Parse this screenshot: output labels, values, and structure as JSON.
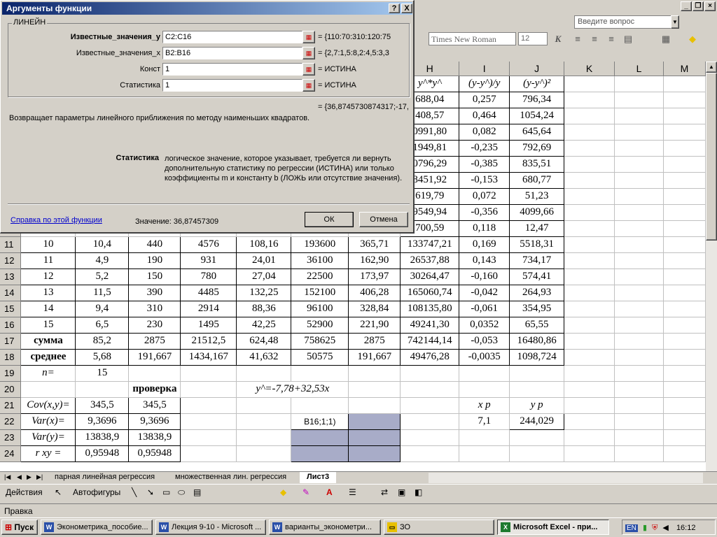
{
  "dialog": {
    "title": "Аргументы функции",
    "function_name": "ЛИНЕЙН",
    "args": [
      {
        "label": "Известные_значения_y",
        "value": "C2:C16",
        "result": "= {110:70:310:120:75",
        "bold": true
      },
      {
        "label": "Известные_значения_x",
        "value": "B2:B16",
        "result": "= {2,7:1,5:8,2:4,5:3,3",
        "bold": false
      },
      {
        "label": "Конст",
        "value": "1",
        "result": "= ИСТИНА",
        "bold": false
      },
      {
        "label": "Статистика",
        "value": "1",
        "result": "= ИСТИНА",
        "bold": false
      }
    ],
    "overall_result": "= {36,8745730874317;-17,",
    "description": "Возвращает параметры линейного приближения по методу наименьших квадратов.",
    "param_name": "Статистика",
    "param_desc": "логическое значение, которое указывает, требуется ли вернуть дополнительную статистику по регрессии (ИСТИНА) или только коэффициенты m и константу b (ЛОЖЬ или отсутствие значения).",
    "help_link": "Справка по этой функции",
    "value_label": "Значение: 36,87457309",
    "ok": "ОК",
    "cancel": "Отмена",
    "help_btn": "?",
    "close_btn": "X"
  },
  "excel": {
    "help_placeholder": "Введите вопрос",
    "font": "Times New Roman",
    "font_size": "12"
  },
  "columns": [
    "H",
    "I",
    "J",
    "K",
    "L",
    "M"
  ],
  "header_row": {
    "h": "y^*y^",
    "i": "(y-y^)/y",
    "j": "(y-y^)²"
  },
  "upper_rows": [
    {
      "h": "688,04",
      "i": "0,257",
      "j": "796,34"
    },
    {
      "h": "408,57",
      "i": "0,464",
      "j": "1054,24"
    },
    {
      "h": "0991,80",
      "i": "0,082",
      "j": "645,64"
    },
    {
      "h": "1949,81",
      "i": "-0,235",
      "j": "792,69"
    },
    {
      "h": "0796,29",
      "i": "-0,385",
      "j": "835,51"
    },
    {
      "h": "8451,92",
      "i": "-0,153",
      "j": "680,77"
    },
    {
      "h": "619,79",
      "i": "0,072",
      "j": "51,23"
    },
    {
      "h": "9549,94",
      "i": "-0,356",
      "j": "4099,66"
    },
    {
      "h": "700,59",
      "i": "0,118",
      "j": "12,47"
    }
  ],
  "data_rows": [
    {
      "rn": "11",
      "a": "10",
      "b": "10,4",
      "c": "440",
      "d": "4576",
      "e": "108,16",
      "f": "193600",
      "g": "365,71",
      "h": "133747,21",
      "i": "0,169",
      "j": "5518,31"
    },
    {
      "rn": "12",
      "a": "11",
      "b": "4,9",
      "c": "190",
      "d": "931",
      "e": "24,01",
      "f": "36100",
      "g": "162,90",
      "h": "26537,88",
      "i": "0,143",
      "j": "734,17"
    },
    {
      "rn": "13",
      "a": "12",
      "b": "5,2",
      "c": "150",
      "d": "780",
      "e": "27,04",
      "f": "22500",
      "g": "173,97",
      "h": "30264,47",
      "i": "-0,160",
      "j": "574,41"
    },
    {
      "rn": "14",
      "a": "13",
      "b": "11,5",
      "c": "390",
      "d": "4485",
      "e": "132,25",
      "f": "152100",
      "g": "406,28",
      "h": "165060,74",
      "i": "-0,042",
      "j": "264,93"
    },
    {
      "rn": "15",
      "a": "14",
      "b": "9,4",
      "c": "310",
      "d": "2914",
      "e": "88,36",
      "f": "96100",
      "g": "328,84",
      "h": "108135,80",
      "i": "-0,061",
      "j": "354,95"
    },
    {
      "rn": "16",
      "a": "15",
      "b": "6,5",
      "c": "230",
      "d": "1495",
      "e": "42,25",
      "f": "52900",
      "g": "221,90",
      "h": "49241,30",
      "i": "0,0352",
      "j": "65,55"
    },
    {
      "rn": "17",
      "a": "сумма",
      "b": "85,2",
      "c": "2875",
      "d": "21512,5",
      "e": "624,48",
      "f": "758625",
      "g": "2875",
      "h": "742144,14",
      "i": "-0,053",
      "j": "16480,86"
    },
    {
      "rn": "18",
      "a": "среднее",
      "b": "5,68",
      "c": "191,667",
      "d": "1434,167",
      "e": "41,632",
      "f": "50575",
      "g": "191,667",
      "h": "49476,28",
      "i": "-0,0035",
      "j": "1098,724"
    }
  ],
  "lower": {
    "n_label": "n=",
    "n_val": "15",
    "check": "проверка",
    "eq": "y^=-7,78+32,53x",
    "cov_label": "Cov(x,y)=",
    "cov1": "345,5",
    "cov2": "345,5",
    "varx_label": "Var(x)=",
    "varx1": "9,3696",
    "varx2": "9,3696",
    "vary_label": "Var(y)=",
    "vary1": "13838,9",
    "vary2": "13838,9",
    "r_label": "r xy =",
    "r1": "0,95948",
    "r2": "0,95948",
    "formula_frag": "B16;1;1)",
    "xp_label": "x p",
    "yp_label": "y p",
    "xp": "7,1",
    "yp": "244,029"
  },
  "row_numbers_lower": [
    "19",
    "20",
    "21",
    "22",
    "23",
    "24"
  ],
  "sheet_tabs": [
    "парная линейная регрессия",
    "множественная лин. регрессия",
    "Лист3"
  ],
  "drawbar": {
    "actions": "Действия",
    "autoshapes": "Автофигуры"
  },
  "status": "Правка",
  "taskbar": {
    "start": "Пуск",
    "tasks": [
      "Эконометрика_пособие...",
      "Лекция 9-10 - Microsoft ...",
      "варианты_эконометри...",
      "ЗО",
      "Microsoft Excel - при..."
    ],
    "lang": "EN",
    "time": "16:12"
  }
}
